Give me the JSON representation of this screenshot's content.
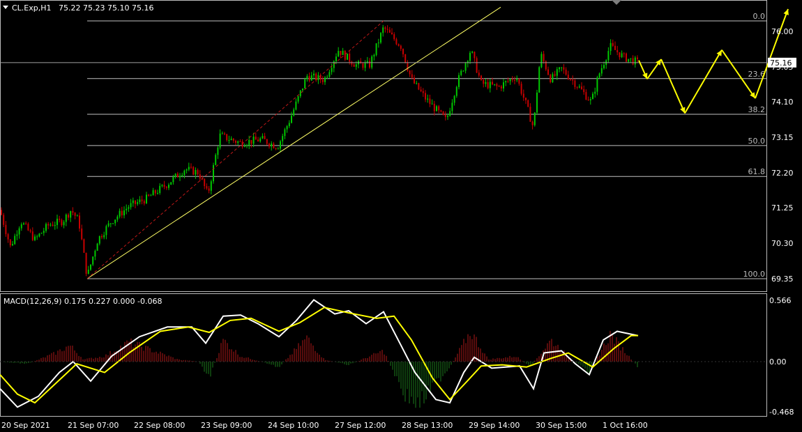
{
  "header": {
    "symbol": "CL.Exp,H1",
    "ohlc": "75.22 75.23 75.10 75.16"
  },
  "price_axis": {
    "labels": [
      "76.00",
      "75.05",
      "74.10",
      "73.15",
      "72.20",
      "71.25",
      "70.30",
      "69.35"
    ],
    "current_price": "75.16"
  },
  "fibonacci": {
    "levels": [
      "0.0",
      "23.6",
      "38.2",
      "50.0",
      "61.8",
      "100.0"
    ]
  },
  "macd": {
    "label": "MACD(12,26,9) 0.175 0.227 0.000 -0.068",
    "axis_labels": [
      "0.566",
      "0.00",
      "-0.468"
    ]
  },
  "time_axis": {
    "labels": [
      "20 Sep 2021",
      "21 Sep 07:00",
      "22 Sep 08:00",
      "23 Sep 09:00",
      "24 Sep 10:00",
      "27 Sep 12:00",
      "28 Sep 13:00",
      "29 Sep 14:00",
      "30 Sep 15:00",
      "1 Oct 16:00"
    ]
  },
  "colors": {
    "background": "#000000",
    "bull": "#00c800",
    "bear": "#c80000",
    "annotation": "#ffff00",
    "grid": "#c0c0c0",
    "macd_line": "#ffffff",
    "signal_line": "#ffff00"
  },
  "chart_data": {
    "type": "candlestick",
    "symbol": "CL.Exp",
    "timeframe": "H1",
    "ylim": [
      69.2,
      76.5
    ],
    "current_price": 75.16,
    "fib_levels": [
      {
        "level": 0.0,
        "price": 76.28
      },
      {
        "level": 23.6,
        "price": 74.73
      },
      {
        "level": 38.2,
        "price": 73.77
      },
      {
        "level": 50.0,
        "price": 72.93
      },
      {
        "level": 61.8,
        "price": 72.1
      },
      {
        "level": 100.0,
        "price": 69.35
      }
    ],
    "close_path": [
      {
        "x": 0,
        "y": 71.2
      },
      {
        "x": 15,
        "y": 70.2
      },
      {
        "x": 30,
        "y": 70.9
      },
      {
        "x": 50,
        "y": 70.4
      },
      {
        "x": 70,
        "y": 70.8
      },
      {
        "x": 90,
        "y": 70.9
      },
      {
        "x": 102,
        "y": 71.2
      },
      {
        "x": 113,
        "y": 70.9
      },
      {
        "x": 125,
        "y": 69.4
      },
      {
        "x": 140,
        "y": 70.4
      },
      {
        "x": 160,
        "y": 70.9
      },
      {
        "x": 185,
        "y": 71.3
      },
      {
        "x": 210,
        "y": 71.5
      },
      {
        "x": 240,
        "y": 71.9
      },
      {
        "x": 265,
        "y": 72.3
      },
      {
        "x": 285,
        "y": 72.2
      },
      {
        "x": 298,
        "y": 71.6
      },
      {
        "x": 315,
        "y": 73.2
      },
      {
        "x": 345,
        "y": 73.0
      },
      {
        "x": 375,
        "y": 73.1
      },
      {
        "x": 398,
        "y": 72.9
      },
      {
        "x": 415,
        "y": 73.6
      },
      {
        "x": 440,
        "y": 74.8
      },
      {
        "x": 465,
        "y": 74.7
      },
      {
        "x": 485,
        "y": 75.5
      },
      {
        "x": 510,
        "y": 75.1
      },
      {
        "x": 530,
        "y": 75.1
      },
      {
        "x": 550,
        "y": 76.1
      },
      {
        "x": 575,
        "y": 75.6
      },
      {
        "x": 590,
        "y": 74.7
      },
      {
        "x": 610,
        "y": 74.2
      },
      {
        "x": 640,
        "y": 73.6
      },
      {
        "x": 655,
        "y": 74.6
      },
      {
        "x": 675,
        "y": 75.5
      },
      {
        "x": 690,
        "y": 74.6
      },
      {
        "x": 715,
        "y": 74.5
      },
      {
        "x": 740,
        "y": 74.8
      },
      {
        "x": 755,
        "y": 74.0
      },
      {
        "x": 765,
        "y": 73.4
      },
      {
        "x": 775,
        "y": 75.4
      },
      {
        "x": 790,
        "y": 74.7
      },
      {
        "x": 805,
        "y": 75.0
      },
      {
        "x": 830,
        "y": 74.5
      },
      {
        "x": 848,
        "y": 74.1
      },
      {
        "x": 858,
        "y": 74.8
      },
      {
        "x": 875,
        "y": 75.6
      },
      {
        "x": 895,
        "y": 75.3
      },
      {
        "x": 915,
        "y": 75.16
      }
    ],
    "macd": {
      "ylim": [
        -0.5,
        0.6
      ],
      "hist": [
        {
          "x": 0,
          "y": 0
        },
        {
          "x": 40,
          "y": -0.02
        },
        {
          "x": 80,
          "y": 0.08
        },
        {
          "x": 100,
          "y": 0.15
        },
        {
          "x": 120,
          "y": 0.02
        },
        {
          "x": 150,
          "y": 0.05
        },
        {
          "x": 185,
          "y": 0.18
        },
        {
          "x": 220,
          "y": 0.1
        },
        {
          "x": 255,
          "y": 0.02
        },
        {
          "x": 285,
          "y": 0.0
        },
        {
          "x": 300,
          "y": -0.15
        },
        {
          "x": 320,
          "y": 0.2
        },
        {
          "x": 345,
          "y": 0.05
        },
        {
          "x": 375,
          "y": 0.0
        },
        {
          "x": 400,
          "y": -0.05
        },
        {
          "x": 440,
          "y": 0.22
        },
        {
          "x": 465,
          "y": 0.02
        },
        {
          "x": 500,
          "y": -0.03
        },
        {
          "x": 550,
          "y": 0.1
        },
        {
          "x": 580,
          "y": -0.3
        },
        {
          "x": 600,
          "y": -0.4
        },
        {
          "x": 625,
          "y": -0.2
        },
        {
          "x": 645,
          "y": -0.05
        },
        {
          "x": 675,
          "y": 0.28
        },
        {
          "x": 700,
          "y": 0.02
        },
        {
          "x": 740,
          "y": 0.05
        },
        {
          "x": 760,
          "y": -0.05
        },
        {
          "x": 790,
          "y": 0.2
        },
        {
          "x": 820,
          "y": 0.02
        },
        {
          "x": 845,
          "y": -0.1
        },
        {
          "x": 875,
          "y": 0.25
        },
        {
          "x": 915,
          "y": -0.05
        }
      ],
      "macd_line": [
        {
          "x": 0,
          "y": -0.25
        },
        {
          "x": 25,
          "y": -0.42
        },
        {
          "x": 55,
          "y": -0.32
        },
        {
          "x": 85,
          "y": -0.1
        },
        {
          "x": 105,
          "y": 0.0
        },
        {
          "x": 130,
          "y": -0.18
        },
        {
          "x": 160,
          "y": 0.05
        },
        {
          "x": 200,
          "y": 0.23
        },
        {
          "x": 240,
          "y": 0.32
        },
        {
          "x": 275,
          "y": 0.32
        },
        {
          "x": 295,
          "y": 0.17
        },
        {
          "x": 320,
          "y": 0.42
        },
        {
          "x": 345,
          "y": 0.43
        },
        {
          "x": 370,
          "y": 0.35
        },
        {
          "x": 400,
          "y": 0.23
        },
        {
          "x": 425,
          "y": 0.38
        },
        {
          "x": 450,
          "y": 0.57
        },
        {
          "x": 480,
          "y": 0.44
        },
        {
          "x": 500,
          "y": 0.47
        },
        {
          "x": 525,
          "y": 0.35
        },
        {
          "x": 550,
          "y": 0.46
        },
        {
          "x": 575,
          "y": 0.15
        },
        {
          "x": 595,
          "y": -0.1
        },
        {
          "x": 625,
          "y": -0.35
        },
        {
          "x": 645,
          "y": -0.38
        },
        {
          "x": 665,
          "y": -0.1
        },
        {
          "x": 680,
          "y": 0.04
        },
        {
          "x": 705,
          "y": -0.06
        },
        {
          "x": 745,
          "y": -0.04
        },
        {
          "x": 765,
          "y": -0.25
        },
        {
          "x": 780,
          "y": 0.08
        },
        {
          "x": 805,
          "y": 0.1
        },
        {
          "x": 825,
          "y": -0.02
        },
        {
          "x": 845,
          "y": -0.12
        },
        {
          "x": 865,
          "y": 0.2
        },
        {
          "x": 885,
          "y": 0.28
        },
        {
          "x": 915,
          "y": 0.24
        }
      ],
      "signal_line": [
        {
          "x": 0,
          "y": -0.12
        },
        {
          "x": 25,
          "y": -0.3
        },
        {
          "x": 50,
          "y": -0.38
        },
        {
          "x": 80,
          "y": -0.2
        },
        {
          "x": 110,
          "y": -0.02
        },
        {
          "x": 150,
          "y": -0.1
        },
        {
          "x": 185,
          "y": 0.08
        },
        {
          "x": 230,
          "y": 0.28
        },
        {
          "x": 270,
          "y": 0.32
        },
        {
          "x": 300,
          "y": 0.27
        },
        {
          "x": 330,
          "y": 0.38
        },
        {
          "x": 360,
          "y": 0.4
        },
        {
          "x": 400,
          "y": 0.28
        },
        {
          "x": 430,
          "y": 0.36
        },
        {
          "x": 465,
          "y": 0.5
        },
        {
          "x": 500,
          "y": 0.45
        },
        {
          "x": 540,
          "y": 0.4
        },
        {
          "x": 565,
          "y": 0.42
        },
        {
          "x": 590,
          "y": 0.2
        },
        {
          "x": 620,
          "y": -0.15
        },
        {
          "x": 645,
          "y": -0.35
        },
        {
          "x": 670,
          "y": -0.18
        },
        {
          "x": 690,
          "y": -0.04
        },
        {
          "x": 720,
          "y": -0.03
        },
        {
          "x": 755,
          "y": -0.05
        },
        {
          "x": 790,
          "y": 0.03
        },
        {
          "x": 815,
          "y": 0.08
        },
        {
          "x": 850,
          "y": -0.05
        },
        {
          "x": 880,
          "y": 0.12
        },
        {
          "x": 905,
          "y": 0.24
        },
        {
          "x": 915,
          "y": 0.24
        }
      ]
    },
    "trendline": {
      "from": {
        "x": 125,
        "y": 69.35
      },
      "to": {
        "x": 718,
        "y": 76.65
      }
    },
    "channel_line": {
      "from": {
        "x": 125,
        "y": 69.35
      },
      "to": {
        "x": 550,
        "y": 76.28
      }
    },
    "forecast_path": [
      {
        "x": 916,
        "y": 75.22
      },
      {
        "x": 928,
        "y": 74.72
      },
      {
        "x": 948,
        "y": 75.25
      },
      {
        "x": 982,
        "y": 73.8
      },
      {
        "x": 1035,
        "y": 75.5
      },
      {
        "x": 1083,
        "y": 74.2
      },
      {
        "x": 1130,
        "y": 76.6
      }
    ]
  }
}
